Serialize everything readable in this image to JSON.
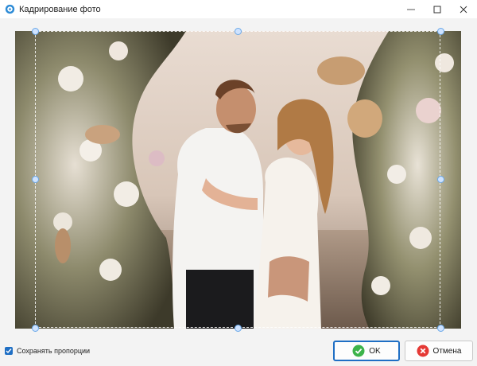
{
  "window": {
    "title": "Кадрирование фото",
    "icons": {
      "app": "app-logo-icon",
      "minimize": "minimize-icon",
      "maximize": "maximize-icon",
      "close": "close-icon"
    }
  },
  "options": {
    "keep_proportions_label": "Сохранять пропорции",
    "keep_proportions_checked": true
  },
  "buttons": {
    "ok_label": "OK",
    "cancel_label": "Отмена",
    "ok_icon": "check-circle-icon",
    "cancel_icon": "cancel-circle-icon"
  },
  "colors": {
    "accent": "#1f6fc4",
    "ok_green": "#3cb34a",
    "cancel_red": "#e53935",
    "handle": "#cfe3ff"
  }
}
